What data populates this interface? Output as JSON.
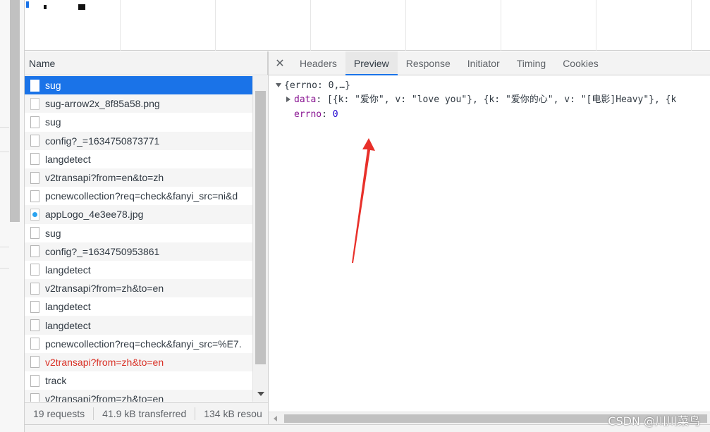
{
  "columns": {
    "name_header": "Name"
  },
  "requests": [
    {
      "name": "sug",
      "icon": "file-icon",
      "state": "selected"
    },
    {
      "name": "sug-arrow2x_8f85a58.png",
      "icon": "image-icon",
      "state": "normal"
    },
    {
      "name": "sug",
      "icon": "file-icon",
      "state": "normal"
    },
    {
      "name": "config?_=1634750873771",
      "icon": "file-icon",
      "state": "normal"
    },
    {
      "name": "langdetect",
      "icon": "file-icon",
      "state": "normal"
    },
    {
      "name": "v2transapi?from=en&to=zh",
      "icon": "file-icon",
      "state": "normal"
    },
    {
      "name": "pcnewcollection?req=check&fanyi_src=ni&d",
      "icon": "file-icon",
      "state": "normal"
    },
    {
      "name": "appLogo_4e3ee78.jpg",
      "icon": "logo-image-icon",
      "state": "normal"
    },
    {
      "name": "sug",
      "icon": "file-icon",
      "state": "normal"
    },
    {
      "name": "config?_=1634750953861",
      "icon": "file-icon",
      "state": "normal"
    },
    {
      "name": "langdetect",
      "icon": "file-icon",
      "state": "normal"
    },
    {
      "name": "v2transapi?from=zh&to=en",
      "icon": "file-icon",
      "state": "normal"
    },
    {
      "name": "langdetect",
      "icon": "file-icon",
      "state": "normal"
    },
    {
      "name": "langdetect",
      "icon": "file-icon",
      "state": "normal"
    },
    {
      "name": "pcnewcollection?req=check&fanyi_src=%E7.",
      "icon": "file-icon",
      "state": "normal"
    },
    {
      "name": "v2transapi?from=zh&to=en",
      "icon": "file-icon",
      "state": "error"
    },
    {
      "name": "track",
      "icon": "file-icon",
      "state": "normal"
    },
    {
      "name": "v2transapi?from=zh&to=en",
      "icon": "file-icon",
      "state": "normal"
    }
  ],
  "status": {
    "requests": "19 requests",
    "transferred": "41.9 kB transferred",
    "resources": "134 kB resou"
  },
  "tabs": [
    "Headers",
    "Preview",
    "Response",
    "Initiator",
    "Timing",
    "Cookies"
  ],
  "active_tab": "Preview",
  "preview": {
    "root": "{errno: 0,…}",
    "data_key": "data",
    "data_value": "[{k: \"爱你\", v: \"love you\"}, {k: \"爱你的心\", v: \"[电影]Heavy\"}, {k",
    "errno_key": "errno",
    "errno_value": "0"
  },
  "watermark": "CSDN @川川菜鸟",
  "colors": {
    "accent": "#1a73e8",
    "error": "#d93025",
    "annotation_arrow": "#e8302a"
  }
}
